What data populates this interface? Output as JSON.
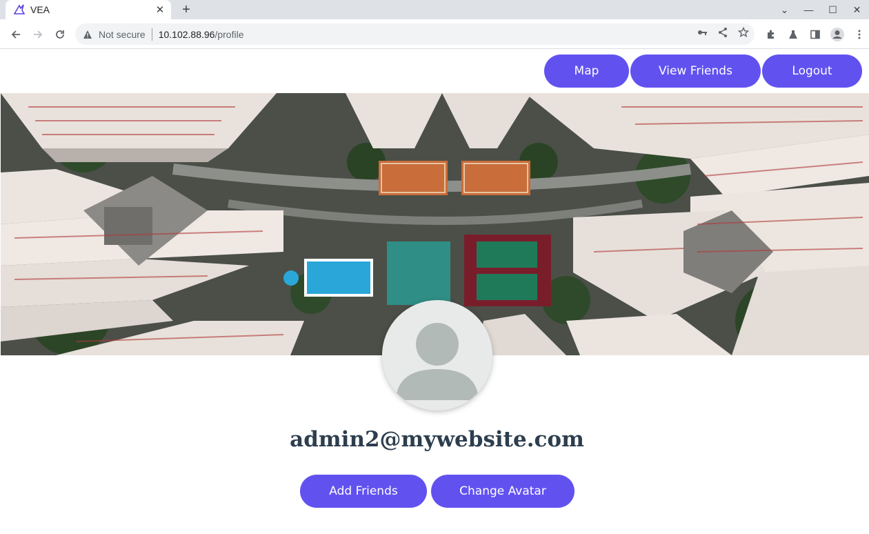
{
  "browser": {
    "tab_title": "VEA",
    "tab_close": "✕",
    "new_tab": "+",
    "window_controls": {
      "minimize": "—",
      "maximize": "☐",
      "close": "✕",
      "dropdown": "⌄"
    },
    "security_label": "Not secure",
    "url_host": "10.102.88.96",
    "url_path": "/profile",
    "icons": [
      "back-icon",
      "forward-icon",
      "reload-icon",
      "key-icon",
      "share-icon",
      "star-icon",
      "extensions-icon",
      "labs-icon",
      "side-panel-icon",
      "profile-icon",
      "menu-icon"
    ]
  },
  "nav": {
    "map_label": "Map",
    "friends_label": "View Friends",
    "logout_label": "Logout"
  },
  "profile": {
    "email": "admin2@mywebsite.com",
    "add_friends_label": "Add Friends",
    "change_avatar_label": "Change Avatar"
  },
  "colors": {
    "accent": "#6152f0",
    "heading": "#2d3e4e",
    "avatar_bg": "#e8eaea",
    "avatar_figure": "#b1bab7"
  }
}
